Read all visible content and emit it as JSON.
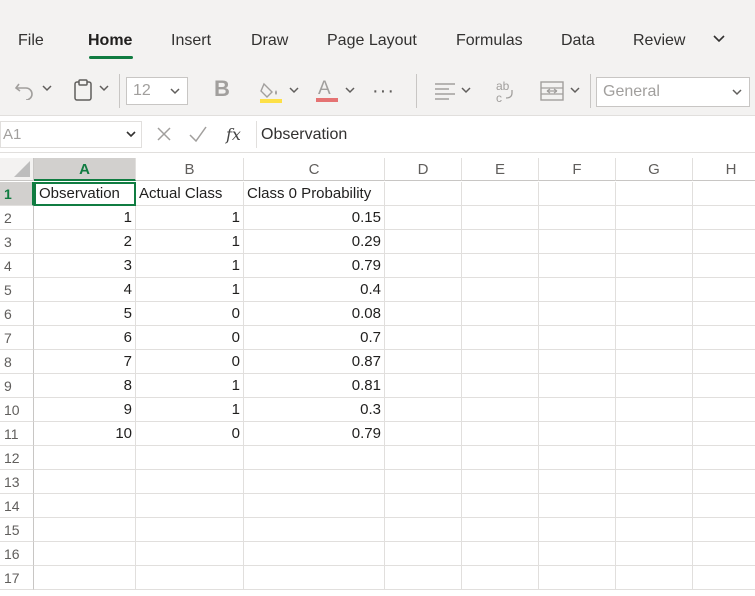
{
  "ribbon": {
    "tabs": [
      "File",
      "Home",
      "Insert",
      "Draw",
      "Page Layout",
      "Formulas",
      "Data",
      "Review"
    ],
    "active_tab": "Home",
    "font_size": "12",
    "number_format": "General",
    "accent_color": "#107c41"
  },
  "formula_bar": {
    "name_box": "A1",
    "fx_label": "fx",
    "value": "Observation"
  },
  "sheet": {
    "columns": [
      "A",
      "B",
      "C",
      "D",
      "E",
      "F",
      "G",
      "H"
    ],
    "rows": [
      "1",
      "2",
      "3",
      "4",
      "5",
      "6",
      "7",
      "8",
      "9",
      "10",
      "11",
      "12",
      "13",
      "14",
      "15",
      "16",
      "17"
    ],
    "headers": [
      "Observation",
      "Actual Class",
      "Class 0 Probability"
    ],
    "data": [
      [
        "1",
        "1",
        "0.15"
      ],
      [
        "2",
        "1",
        "0.29"
      ],
      [
        "3",
        "1",
        "0.79"
      ],
      [
        "4",
        "1",
        "0.4"
      ],
      [
        "5",
        "0",
        "0.08"
      ],
      [
        "6",
        "0",
        "0.7"
      ],
      [
        "7",
        "0",
        "0.87"
      ],
      [
        "8",
        "1",
        "0.81"
      ],
      [
        "9",
        "1",
        "0.3"
      ],
      [
        "10",
        "0",
        "0.79"
      ]
    ]
  }
}
